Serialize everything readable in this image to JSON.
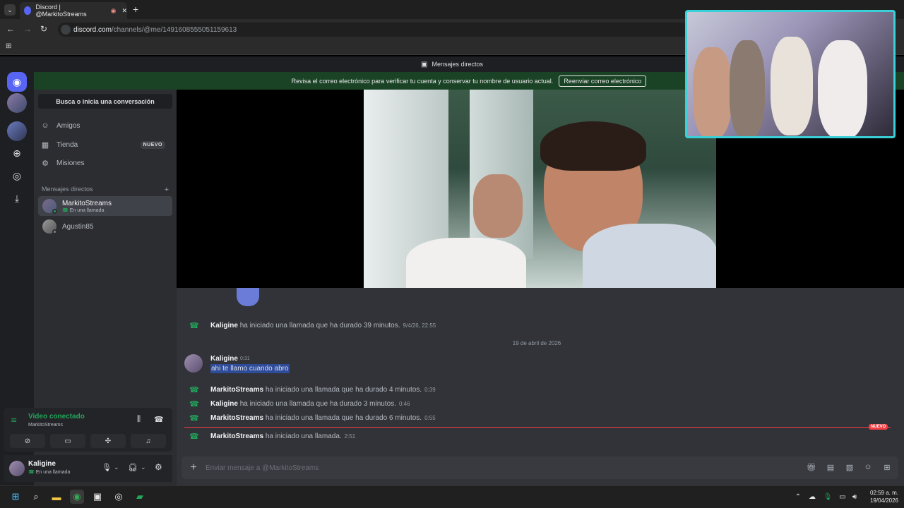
{
  "browser": {
    "tab_title": "Discord | @MarkitoStreams",
    "url_domain": "discord.com",
    "url_path": "/channels/@me/1491608555051159613"
  },
  "discord": {
    "window_title": "Mensajes directos",
    "banner": {
      "text": "Revisa el correo electrónico para verificar tu cuenta y conservar tu nombre de usuario actual.",
      "button": "Reenviar correo electrónico"
    },
    "search_placeholder": "Busca o inicia una conversación",
    "nav": [
      {
        "label": "Amigos",
        "icon": "friends-icon"
      },
      {
        "label": "Tienda",
        "icon": "shop-icon",
        "badge": "NUEVO"
      },
      {
        "label": "Misiones",
        "icon": "quests-icon"
      }
    ],
    "dm_header": "Mensajes directos",
    "dms": [
      {
        "name": "MarkitoStreams",
        "status": "En una llamada"
      },
      {
        "name": "Agustin85",
        "status": ""
      }
    ],
    "voice": {
      "status": "Video conectado",
      "channel": "MarkitoStreams"
    },
    "user": {
      "name": "Kaligine",
      "status": "En una llamada"
    },
    "chat": {
      "call_1": {
        "author": "Kaligine",
        "text": "ha iniciado una llamada que ha durado 39 minutos.",
        "time": "9/4/26, 22:55"
      },
      "date_separator": "19 de abril de 2026",
      "message": {
        "author": "Kaligine",
        "time": "0:31",
        "text": "ahi te llamo cuando abro"
      },
      "call_2": {
        "author": "MarkitoStreams",
        "text": "ha iniciado una llamada que ha durado 4 minutos.",
        "time": "0:39"
      },
      "call_3": {
        "author": "Kaligine",
        "text": "ha iniciado una llamada que ha durado 3 minutos.",
        "time": "0:46"
      },
      "call_4": {
        "author": "MarkitoStreams",
        "text": "ha iniciado una llamada que ha durado 6 minutos.",
        "time": "0:55"
      },
      "new_badge": "NUEVO",
      "call_5": {
        "author": "MarkitoStreams",
        "text": "ha iniciado una llamada.",
        "time": "2:51"
      },
      "composer_placeholder": "Enviar mensaje a @MarkitoStreams"
    }
  },
  "taskbar": {
    "time": "02:59 a. m.",
    "date": "19/04/2026"
  },
  "colors": {
    "accent_green": "#23a55a",
    "blurple": "#5865f2",
    "pip_border": "#39d0d8",
    "new_red": "#f23f43"
  }
}
